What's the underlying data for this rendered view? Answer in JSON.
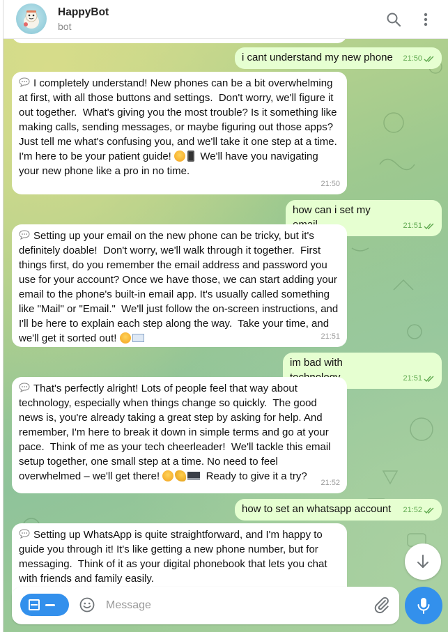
{
  "header": {
    "title": "HappyBot",
    "subtitle": "bot"
  },
  "messages": [
    {
      "dir": "out",
      "text": "i cant understand my new phone",
      "time": "21:50"
    },
    {
      "dir": "in",
      "text": "I completely understand! New phones can be a bit overwhelming at first, with all those buttons and settings.  Don't worry, we'll figure it out together.  What's giving you the most trouble? Is it something like making calls, sending messages, or maybe figuring out those apps? Just tell me what's confusing you, and we'll take it one step at a time.  I'm here to be your patient guide!",
      "tail": "We'll have you navigating your new phone like a pro in no time.",
      "time": "21:50"
    },
    {
      "dir": "out",
      "text": "how can i set my email",
      "time": "21:51"
    },
    {
      "dir": "in",
      "text": "Setting up your email on the new phone can be tricky, but it's definitely doable!  Don't worry, we'll walk through it together.  First things first, do you remember the email address and password you use for your account? Once we have those, we can start adding your email to the phone's built-in email app. It's usually called something like \"Mail\" or \"Email.\"  We'll just follow the on-screen instructions, and I'll be here to explain each step along the way.  Take your time, and we'll get it sorted out!",
      "time": "21:51"
    },
    {
      "dir": "out",
      "text": "im bad with technology",
      "time": "21:51"
    },
    {
      "dir": "in",
      "text": "That's perfectly alright! Lots of people feel that way about technology, especially when things change so quickly.  The good news is, you're already taking a great step by asking for help. And remember, I'm here to break it down in simple terms and go at your pace.  Think of me as your tech cheerleader!  We'll tackle this email setup together, one small step at a time. No need to feel overwhelmed – we'll get there!",
      "tail": "Ready to give it a try?",
      "time": "21:52"
    },
    {
      "dir": "out",
      "text": "how to set an whatsapp account",
      "time": "21:52"
    },
    {
      "dir": "in",
      "text": "Setting up WhatsApp is quite straightforward, and I'm happy to guide you through it! It's like getting a new phone number, but for messaging.  Think of it as your digital phonebook that lets you chat with friends and family easily."
    }
  ],
  "composer": {
    "placeholder": "Message"
  },
  "icons": {
    "search": "search-icon",
    "more": "more-vertical-icon",
    "scroll": "arrow-down-icon",
    "emoji": "smiley-icon",
    "attach": "paperclip-icon",
    "mic": "microphone-icon",
    "menu": "bot-menu-icon"
  },
  "colors": {
    "accent": "#3390ec",
    "outgoing_bubble": "#e6ffd1",
    "incoming_bubble": "#ffffff",
    "check": "#5fa94f"
  }
}
